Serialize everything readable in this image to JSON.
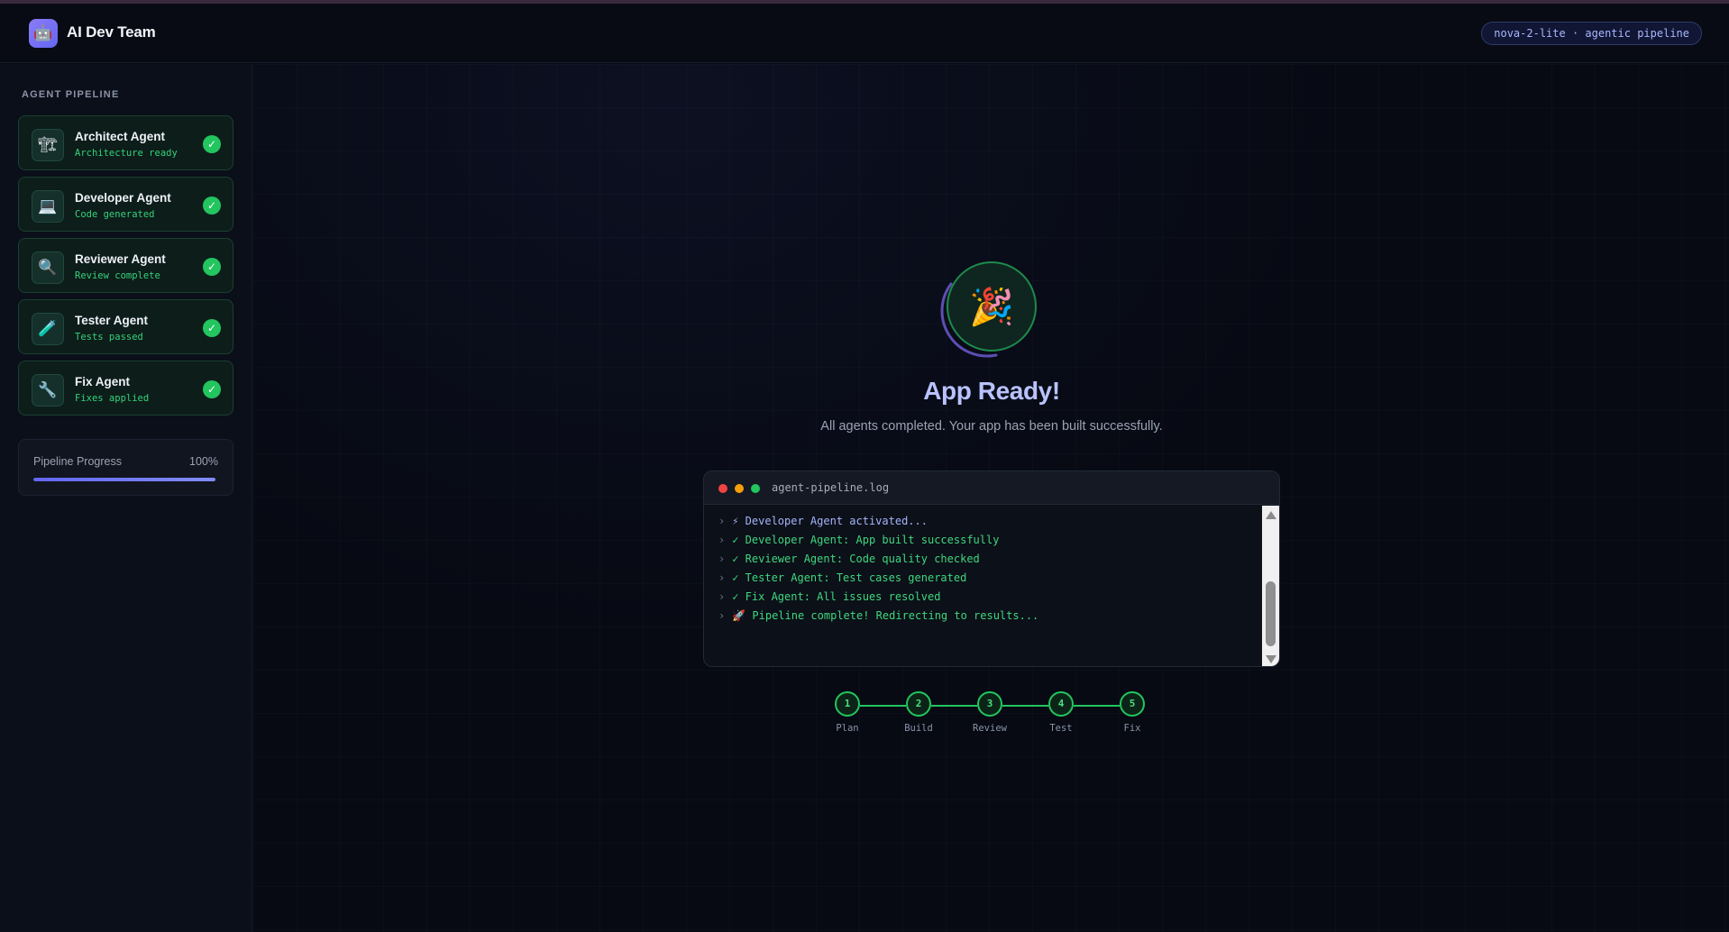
{
  "header": {
    "logo_icon": "robot-icon",
    "title": "AI Dev Team",
    "model_badge": "nova-2-lite · agentic pipeline"
  },
  "sidebar": {
    "heading": "AGENT PIPELINE",
    "agents": [
      {
        "icon": "🏗",
        "icon_name": "building-construction-icon",
        "name": "Architect Agent",
        "status": "Architecture ready",
        "done": true
      },
      {
        "icon": "💻",
        "icon_name": "laptop-icon",
        "name": "Developer Agent",
        "status": "Code generated",
        "done": true
      },
      {
        "icon": "🔍",
        "icon_name": "magnifier-icon",
        "name": "Reviewer Agent",
        "status": "Review complete",
        "done": true
      },
      {
        "icon": "🧪",
        "icon_name": "test-tube-icon",
        "name": "Tester Agent",
        "status": "Tests passed",
        "done": true
      },
      {
        "icon": "🔧",
        "icon_name": "wrench-icon",
        "name": "Fix Agent",
        "status": "Fixes applied",
        "done": true
      }
    ],
    "check_glyph": "✓",
    "progress": {
      "label": "Pipeline Progress",
      "value_text": "100%",
      "value": 1.0
    }
  },
  "main": {
    "celebration_icon": "🎉",
    "title": "App Ready!",
    "subtitle": "All agents completed. Your app has been built successfully."
  },
  "terminal": {
    "title": "agent-pipeline.log",
    "prompt": "›",
    "lines": [
      {
        "text": "⚡ Developer Agent activated...",
        "kind": "info"
      },
      {
        "text": "✓ Developer Agent: App built successfully",
        "kind": "ok"
      },
      {
        "text": "✓ Reviewer Agent: Code quality checked",
        "kind": "ok"
      },
      {
        "text": "✓ Tester Agent: Test cases generated",
        "kind": "ok"
      },
      {
        "text": "✓ Fix Agent: All issues resolved",
        "kind": "ok"
      },
      {
        "text": "🚀 Pipeline complete! Redirecting to results...",
        "kind": "ok"
      }
    ]
  },
  "steps": [
    {
      "number": "1",
      "label": "Plan"
    },
    {
      "number": "2",
      "label": "Build"
    },
    {
      "number": "3",
      "label": "Review"
    },
    {
      "number": "4",
      "label": "Test"
    },
    {
      "number": "5",
      "label": "Fix"
    }
  ],
  "colors": {
    "accent": "#6366f1",
    "success": "#22c55e",
    "background": "#070a13",
    "title_lavender": "#b9c2ff"
  }
}
